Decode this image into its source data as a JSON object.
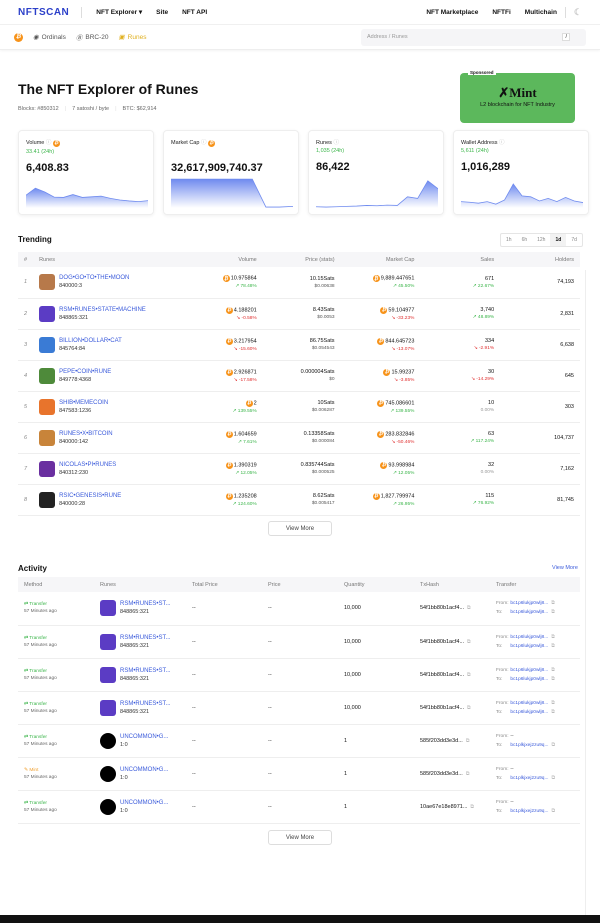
{
  "header": {
    "logo": "NFTSCAN",
    "nav": [
      "NFT Explorer ▾",
      "Site",
      "NFT API"
    ],
    "right": [
      "NFT Marketplace",
      "NFTFi",
      "Multichain"
    ]
  },
  "subnav": {
    "items": [
      "Ordinals",
      "BRC-20",
      "Runes"
    ],
    "search_placeholder": "Address / Runes",
    "shortcut": "/"
  },
  "hero": {
    "title": "The NFT Explorer of Runes",
    "blocks": "Blocks: #850312",
    "fee": "7 satoshi / byte",
    "btc": "BTC: $62,914"
  },
  "ad": {
    "sponsored": "Sponsored",
    "brand": "Mint",
    "tagline": "L2 blockchain for NFT Industry"
  },
  "cards": [
    {
      "label": "Volume",
      "change": "33.41 (24h)",
      "value": "6,408.83",
      "spark": [
        40,
        62,
        50,
        34,
        33,
        42,
        33,
        35,
        37,
        30,
        25,
        22,
        20,
        23
      ]
    },
    {
      "label": "Market Cap",
      "change": "",
      "value": "32,617,909,740.37",
      "spark": [
        90,
        90,
        90,
        90,
        90,
        90,
        90,
        3,
        3,
        5
      ]
    },
    {
      "label": "Runes",
      "change": "1,035 (24h)",
      "value": "86,422",
      "spark": [
        4,
        3,
        4,
        5,
        6,
        8,
        7,
        9,
        8,
        35,
        30,
        85,
        60
      ]
    },
    {
      "label": "Wallet Address",
      "change": "5,611 (24h)",
      "value": "1,016,289",
      "spark": [
        20,
        18,
        15,
        20,
        12,
        25,
        75,
        38,
        35,
        22,
        30,
        20,
        33,
        22,
        17
      ]
    }
  ],
  "trending": {
    "title": "Trending",
    "timeframes": [
      "1h",
      "6h",
      "12h",
      "1d",
      "7d"
    ],
    "active_timeframe": "1d",
    "columns": [
      "#",
      "Runes",
      "Volume",
      "Price (stats)",
      "Market Cap",
      "Sales",
      "Holders"
    ],
    "rows": [
      {
        "rank": "1",
        "name": "DOG•GO•TO•THE•MOON",
        "id": "840000:3",
        "volume": "10.975864",
        "vol_chg": "↗ 78.48%",
        "vol_dir": "up",
        "price": "10.15Sats",
        "price_usd": "$0.00638",
        "mcap": "9,889.447651",
        "mcap_chg": "↗ 45.50%",
        "mcap_dir": "up",
        "sales": "671",
        "sales_chg": "↗ 22.67%",
        "sales_dir": "up",
        "holders": "74,193",
        "color": "#b7794a"
      },
      {
        "rank": "2",
        "name": "RSM•RUNES•STATE•MACHINE",
        "id": "848865:321",
        "volume": "4.188201",
        "vol_chg": "↘ -0.58%",
        "vol_dir": "dn",
        "price": "8.43Sats",
        "price_usd": "$0.0053",
        "mcap": "59.104977",
        "mcap_chg": "↘ -33.23%",
        "mcap_dir": "dn",
        "sales": "3,740",
        "sales_chg": "↗ 48.89%",
        "sales_dir": "up",
        "holders": "2,831",
        "color": "#5b3cc4"
      },
      {
        "rank": "3",
        "name": "BILLION•DOLLAR•CAT",
        "id": "845764:84",
        "volume": "3.217954",
        "vol_chg": "↘ -15.60%",
        "vol_dir": "dn",
        "price": "86.75Sats",
        "price_usd": "$0.054543",
        "mcap": "844.645723",
        "mcap_chg": "↘ -13.07%",
        "mcap_dir": "dn",
        "sales": "334",
        "sales_chg": "↘ -2.91%",
        "sales_dir": "dn",
        "holders": "6,638",
        "color": "#3a7bd5"
      },
      {
        "rank": "4",
        "name": "PEPE•COIN•RUNE",
        "id": "849778:4368",
        "volume": "2.926871",
        "vol_chg": "↘ -17.58%",
        "vol_dir": "dn",
        "price": "0.000004Sats",
        "price_usd": "$0",
        "mcap": "15.99237",
        "mcap_chg": "↘ -3.85%",
        "mcap_dir": "dn",
        "sales": "30",
        "sales_chg": "↘ -14.29%",
        "sales_dir": "dn",
        "holders": "645",
        "color": "#4e8a3a"
      },
      {
        "rank": "5",
        "name": "SHIB•MEMECOIN",
        "id": "847583:1236",
        "volume": "2",
        "vol_chg": "↗ 139.55%",
        "vol_dir": "up",
        "price": "10Sats",
        "price_usd": "$0.006287",
        "mcap": "745.086601",
        "mcap_chg": "↗ 139.55%",
        "mcap_dir": "up",
        "sales": "10",
        "sales_chg": "0.00%",
        "sales_dir": "zr",
        "holders": "303",
        "color": "#e8742c"
      },
      {
        "rank": "6",
        "name": "RUNES•X•BITCOIN",
        "id": "840000:142",
        "volume": "1.604659",
        "vol_chg": "↗ 7.61%",
        "vol_dir": "up",
        "price": "0.13358Sats",
        "price_usd": "$0.000084",
        "mcap": "283.832846",
        "mcap_chg": "↘ -50.46%",
        "mcap_dir": "dn",
        "sales": "63",
        "sales_chg": "↗ 117.24%",
        "sales_dir": "up",
        "holders": "104,737",
        "color": "#c8843a"
      },
      {
        "rank": "7",
        "name": "NICOLAS•PI•RUNES",
        "id": "840312:230",
        "volume": "1.390319",
        "vol_chg": "↗ 12.05%",
        "vol_dir": "up",
        "price": "0.835744Sats",
        "price_usd": "$0.000525",
        "mcap": "93.998984",
        "mcap_chg": "↗ 12.05%",
        "mcap_dir": "up",
        "sales": "32",
        "sales_chg": "0.00%",
        "sales_dir": "zr",
        "holders": "7,162",
        "color": "#6a2fa0"
      },
      {
        "rank": "8",
        "name": "RSIC•GENESIS•RUNE",
        "id": "840000:28",
        "volume": "1.235208",
        "vol_chg": "↗ 124.60%",
        "vol_dir": "up",
        "price": "8.62Sats",
        "price_usd": "$0.005417",
        "mcap": "1,827.799974",
        "mcap_chg": "↗ 26.95%",
        "mcap_dir": "up",
        "sales": "115",
        "sales_chg": "↗ 76.92%",
        "sales_dir": "up",
        "holders": "81,745",
        "color": "#222"
      }
    ],
    "view_more": "View More"
  },
  "activity": {
    "title": "Activity",
    "view_more_link": "View More",
    "view_more": "View More",
    "columns": [
      "Method",
      "Runes",
      "Total Price",
      "Price",
      "Quantity",
      "TxHash",
      "Transfer"
    ],
    "from_label": "From:",
    "to_label": "To:",
    "rows": [
      {
        "method": "Transfer",
        "time": "57 Minutes ago",
        "name": "RSM•RUNES•ST...",
        "id": "848865:321",
        "total": "--",
        "price": "--",
        "qty": "10,000",
        "hash": "54f1bb80b1acf4...",
        "from": "bc1p6lukjp0wlj8...",
        "to": "bc1p6lukjp0wlj8...",
        "color": "#5b3cc4"
      },
      {
        "method": "Transfer",
        "time": "57 Minutes ago",
        "name": "RSM•RUNES•ST...",
        "id": "848865:321",
        "total": "--",
        "price": "--",
        "qty": "10,000",
        "hash": "54f1bb80b1acf4...",
        "from": "bc1p6lukjp0wlj8...",
        "to": "bc1p6lukjp0wlj8...",
        "color": "#5b3cc4"
      },
      {
        "method": "Transfer",
        "time": "57 Minutes ago",
        "name": "RSM•RUNES•ST...",
        "id": "848865:321",
        "total": "--",
        "price": "--",
        "qty": "10,000",
        "hash": "54f1bb80b1acf4...",
        "from": "bc1p6lukjp0wlj8...",
        "to": "bc1p6lukjp0wlj8...",
        "color": "#5b3cc4"
      },
      {
        "method": "Transfer",
        "time": "57 Minutes ago",
        "name": "RSM•RUNES•ST...",
        "id": "848865:321",
        "total": "--",
        "price": "--",
        "qty": "10,000",
        "hash": "54f1bb80b1acf4...",
        "from": "bc1p6lukjp0wlj8...",
        "to": "bc1p6lukjp0wlj8...",
        "color": "#5b3cc4"
      },
      {
        "method": "Transfer",
        "time": "57 Minutes ago",
        "name": "UNCOMMON•G...",
        "id": "1:0",
        "total": "--",
        "price": "--",
        "qty": "1",
        "hash": "585f203dd3e3d...",
        "from": "--",
        "to": "bc1plkjxej2zu9q...",
        "color": "#000"
      },
      {
        "method": "Mint",
        "time": "57 Minutes ago",
        "name": "UNCOMMON•G...",
        "id": "1:0",
        "total": "--",
        "price": "--",
        "qty": "1",
        "hash": "585f203dd3e3d...",
        "from": "--",
        "to": "bc1plkjxej2zu9q...",
        "color": "#000"
      },
      {
        "method": "Transfer",
        "time": "57 Minutes ago",
        "name": "UNCOMMON•G...",
        "id": "1:0",
        "total": "--",
        "price": "--",
        "qty": "1",
        "hash": "10ae67e18e8971...",
        "from": "--",
        "to": "bc1plkjxej2zu9q...",
        "color": "#000"
      }
    ]
  }
}
